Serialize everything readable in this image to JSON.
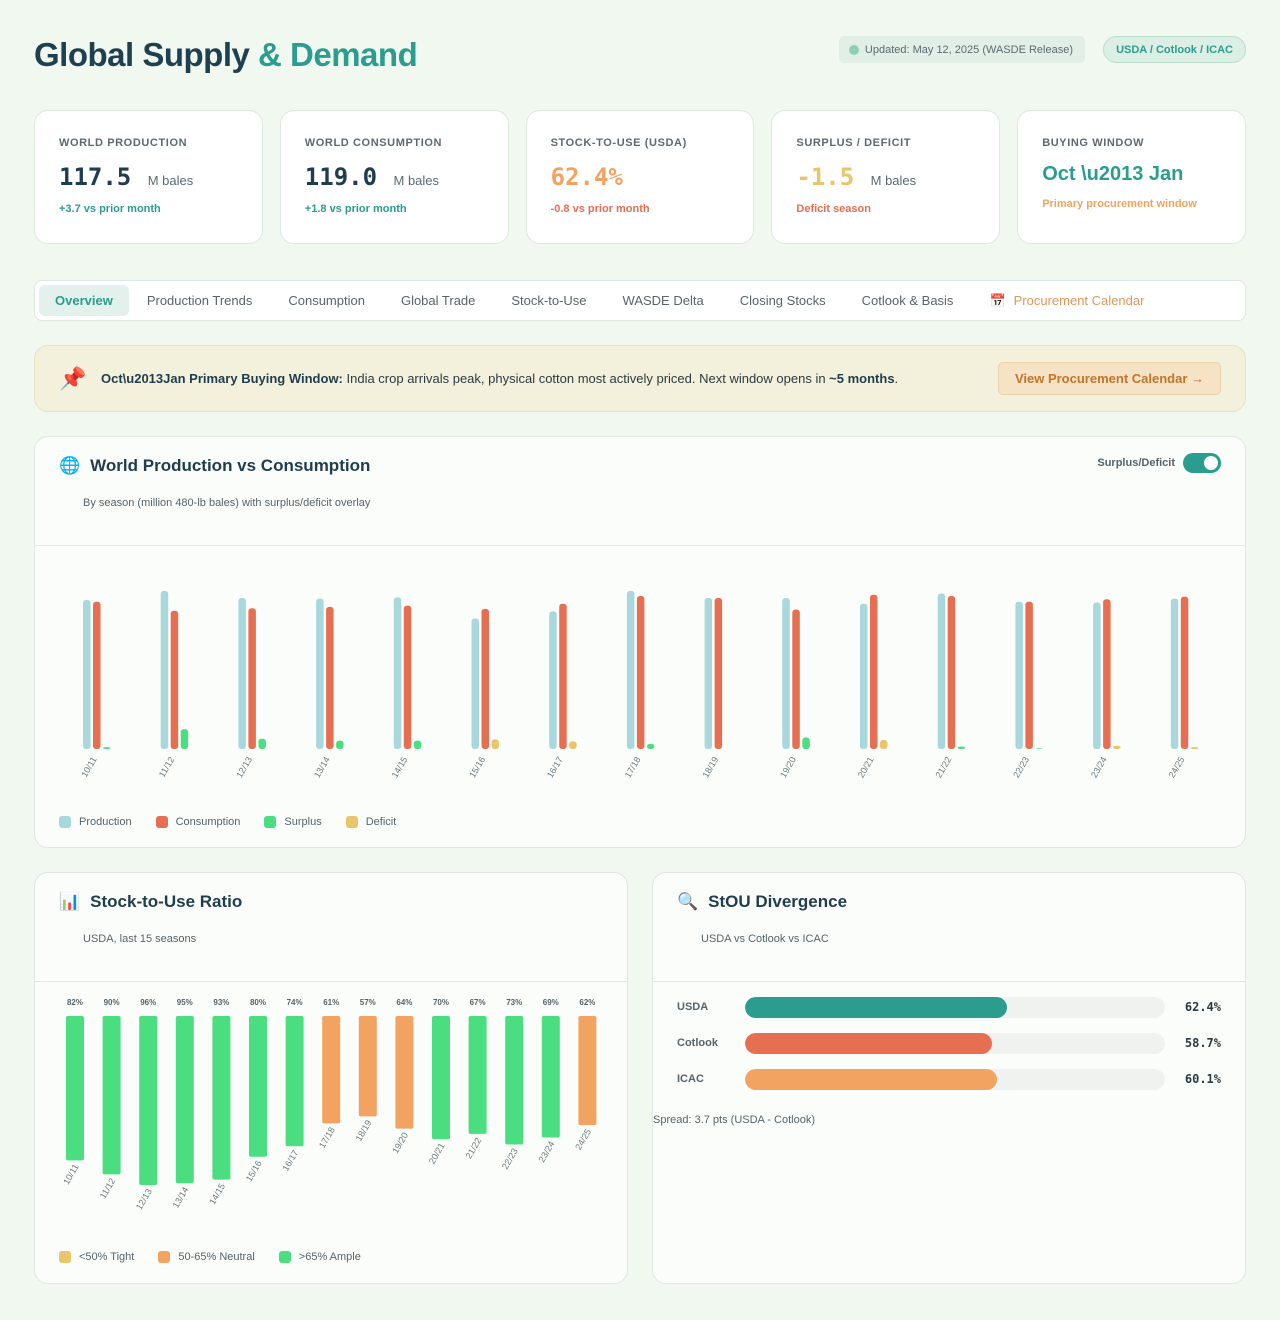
{
  "header": {
    "title_main": "Global Supply",
    "title_accent": "& Demand",
    "updated": "Updated: May 12, 2025 (WASDE Release)",
    "sources": "USDA / Cotlook / ICAC"
  },
  "kpis": [
    {
      "label": "WORLD PRODUCTION",
      "value": "117.5",
      "unit": "M bales",
      "delta": "+3.7 vs prior month",
      "value_color": "#1f3d4c",
      "delta_color": "#2a9d8f"
    },
    {
      "label": "WORLD CONSUMPTION",
      "value": "119.0",
      "unit": "M bales",
      "delta": "+1.8 vs prior month",
      "value_color": "#1f3d4c",
      "delta_color": "#2a9d8f"
    },
    {
      "label": "STOCK-TO-USE (USDA)",
      "value": "62.4%",
      "unit": "",
      "delta": "-0.8 vs prior month",
      "value_color": "#f2a261",
      "delta_color": "#e76f51"
    },
    {
      "label": "SURPLUS / DEFICIT",
      "value": "-1.5",
      "unit": "M bales",
      "delta": "Deficit season",
      "value_color": "#e9c46a",
      "delta_color": "#e76f51"
    }
  ],
  "buying_window": {
    "label": "BUYING WINDOW",
    "value": "Oct \\u2013 Jan",
    "note": "Primary procurement window"
  },
  "tabs": [
    "Overview",
    "Production Trends",
    "Consumption",
    "Global Trade",
    "Stock-to-Use",
    "WASDE Delta",
    "Closing Stocks",
    "Cotlook & Basis"
  ],
  "tab_calendar": "Procurement Calendar",
  "banner": {
    "bold": "Oct\\u2013Jan Primary Buying Window:",
    "text": " India crop arrivals peak, physical cotton most actively priced. Next window opens in ",
    "highlight": "~5 months",
    "end": ".",
    "button": "View Procurement Calendar →"
  },
  "prod_panel": {
    "title": "World Production vs Consumption",
    "subtitle": "By season (million 480-lb bales) with surplus/deficit overlay",
    "toggle_label": "Surplus/Deficit",
    "legend": [
      {
        "label": "Production",
        "color": "#a8d8dc"
      },
      {
        "label": "Consumption",
        "color": "#e76f51"
      },
      {
        "label": "Surplus",
        "color": "#4ade80"
      },
      {
        "label": "Deficit",
        "color": "#e9c46a"
      }
    ]
  },
  "stu_panel": {
    "title": "Stock-to-Use Ratio",
    "subtitle": "USDA, last 15 seasons",
    "legend": [
      {
        "label": "<50% Tight",
        "color": "#e9c46a"
      },
      {
        "label": "50-65% Neutral",
        "color": "#f2a261"
      },
      {
        "label": ">65% Ample",
        "color": "#4ade80"
      }
    ]
  },
  "div_panel": {
    "title": "StOU Divergence",
    "subtitle": "USDA vs Cotlook vs ICAC",
    "rows": [
      {
        "label": "USDA",
        "value": "62.4%",
        "fraction": 0.624,
        "color": "#2a9d8f"
      },
      {
        "label": "Cotlook",
        "value": "58.7%",
        "fraction": 0.587,
        "color": "#e76f51"
      },
      {
        "label": "ICAC",
        "value": "60.1%",
        "fraction": 0.601,
        "color": "#f2a261"
      }
    ],
    "spread": "Spread: 3.7 pts (USDA - Cotlook)"
  },
  "chart_data": [
    {
      "type": "bar",
      "categories": [
        "10/11",
        "11/12",
        "12/13",
        "13/14",
        "14/15",
        "15/16",
        "16/17",
        "17/18",
        "18/19",
        "19/20",
        "20/21",
        "21/22",
        "22/23",
        "23/24",
        "24/25"
      ],
      "series": [
        {
          "name": "Production",
          "values": [
            116.5,
            123.5,
            118.0,
            117.5,
            118.5,
            102.0,
            107.5,
            123.5,
            118.0,
            118.0,
            113.5,
            121.5,
            115.0,
            114.5,
            117.5
          ]
        },
        {
          "name": "Consumption",
          "values": [
            115.0,
            108.0,
            110.0,
            111.0,
            112.0,
            109.5,
            113.5,
            119.5,
            118.0,
            109.0,
            120.5,
            119.5,
            115.0,
            117.0,
            119.0
          ]
        },
        {
          "name": "Surplus",
          "values": [
            1.5,
            15.5,
            8.0,
            6.5,
            6.5,
            0,
            0,
            4.0,
            0,
            9.0,
            0,
            2.0,
            0.5,
            0,
            0
          ]
        },
        {
          "name": "Deficit",
          "values": [
            0,
            0,
            0,
            0,
            0,
            7.5,
            6.0,
            0,
            0,
            0,
            7.0,
            0,
            0,
            2.5,
            1.5
          ]
        }
      ],
      "ylim": [
        0,
        125
      ]
    },
    {
      "type": "bar",
      "categories": [
        "10/11",
        "11/12",
        "12/13",
        "13/14",
        "14/15",
        "15/16",
        "16/17",
        "17/18",
        "18/19",
        "19/20",
        "20/21",
        "21/22",
        "22/23",
        "23/24",
        "24/25"
      ],
      "values": [
        82,
        90,
        96,
        95,
        93,
        80,
        74,
        61,
        57,
        64,
        70,
        67,
        73,
        69,
        62
      ],
      "value_labels": [
        "82%",
        "90%",
        "96%",
        "95%",
        "93%",
        "80%",
        "74%",
        "61%",
        "57%",
        "64%",
        "70%",
        "67%",
        "73%",
        "69%",
        "62%"
      ],
      "colors": [
        "#4ade80",
        "#4ade80",
        "#4ade80",
        "#4ade80",
        "#4ade80",
        "#4ade80",
        "#4ade80",
        "#f2a261",
        "#f2a261",
        "#f2a261",
        "#4ade80",
        "#4ade80",
        "#4ade80",
        "#4ade80",
        "#f2a261"
      ],
      "ylim": [
        0,
        100
      ]
    }
  ]
}
